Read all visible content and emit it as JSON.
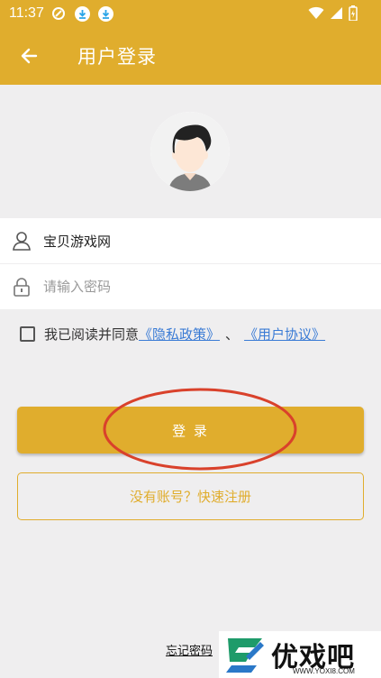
{
  "status_bar": {
    "time": "11:37",
    "icons": [
      "tencent-icon",
      "download-icon",
      "download-icon",
      "wifi-icon",
      "signal-icon",
      "battery-icon"
    ]
  },
  "app_bar": {
    "back_icon": "arrow-left-icon",
    "title": "用户登录"
  },
  "avatar": {
    "icon": "user-avatar-icon"
  },
  "username": {
    "icon": "user-icon",
    "value": "宝贝游戏网"
  },
  "password": {
    "icon": "lock-icon",
    "placeholder": "请输入密码",
    "value": ""
  },
  "agreement": {
    "prefix": "我已阅读并同意",
    "privacy_link": "《隐私政策》",
    "separator": "、",
    "user_link": "《用户协议》",
    "checked": false
  },
  "login_button": {
    "label": "登 录"
  },
  "register_button": {
    "label": "没有账号？快速注册"
  },
  "forgot_link": "忘记密码",
  "watermark": {
    "brand": "优戏吧",
    "url": "WWW.YOXI8.COM"
  },
  "colors": {
    "accent": "#e0ad2d",
    "link": "#3a7bd5",
    "annotation": "#d9412b",
    "background": "#efeeef"
  }
}
